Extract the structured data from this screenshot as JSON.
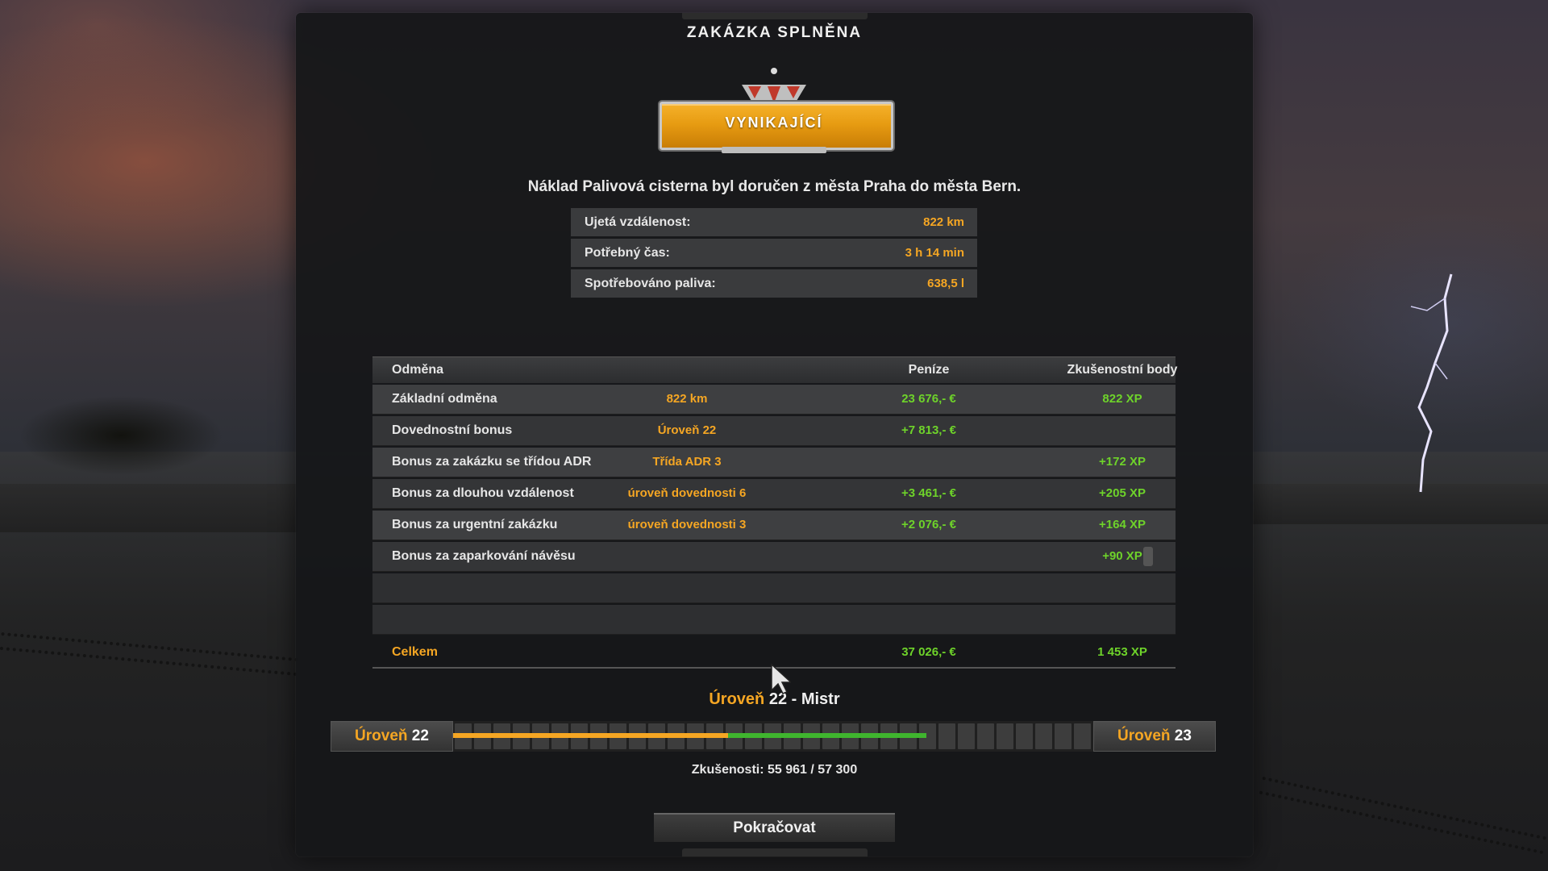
{
  "dialog": {
    "title": "ZAKÁZKA SPLNĚNA",
    "rating_badge": "VYNIKAJÍCÍ",
    "delivery_text": "Náklad Palivová cisterna byl doručen z města Praha do města Bern."
  },
  "stats": [
    {
      "label": "Ujetá vzdálenost:",
      "value": "822 km"
    },
    {
      "label": "Potřebný čas:",
      "value": "3 h 14 min"
    },
    {
      "label": "Spotřebováno paliva:",
      "value": "638,5 l"
    }
  ],
  "rewards": {
    "headers": {
      "name": "Odměna",
      "money": "Peníze",
      "xp": "Zkušenostní body"
    },
    "rows": [
      {
        "name": "Základní odměna",
        "detail": "822 km",
        "money": "23 676,- €",
        "xp": "822 XP"
      },
      {
        "name": "Dovednostní bonus",
        "detail": "Úroveň 22",
        "money": "+7 813,- €",
        "xp": ""
      },
      {
        "name": "Bonus za zakázku se třídou ADR",
        "detail": "Třída ADR 3",
        "money": "",
        "xp": "+172 XP"
      },
      {
        "name": "Bonus za dlouhou vzdálenost",
        "detail": "úroveň dovednosti 6",
        "money": "+3 461,- €",
        "xp": "+205 XP"
      },
      {
        "name": "Bonus za urgentní zakázku",
        "detail": "úroveň dovednosti 3",
        "money": "+2 076,- €",
        "xp": "+164 XP"
      },
      {
        "name": "Bonus za zaparkování návěsu",
        "detail": "",
        "money": "",
        "xp": "+90 XP"
      }
    ],
    "total": {
      "name": "Celkem",
      "money": "37 026,- €",
      "xp": "1 453 XP"
    }
  },
  "level": {
    "current_word": "Úroveň",
    "current_rest": " 22 - Mistr",
    "left_word": "Úroveň",
    "left_num": "22",
    "right_word": "Úroveň",
    "right_num": "23",
    "xp_text": "Zkušenosti: 55 961 / 57 300",
    "progress_before": 0.43,
    "progress_after": 0.74
  },
  "buttons": {
    "continue": "Pokračovat"
  },
  "colors": {
    "accent": "#f5a623",
    "positive": "#6ed32a",
    "progress_green": "#3fb52e"
  }
}
